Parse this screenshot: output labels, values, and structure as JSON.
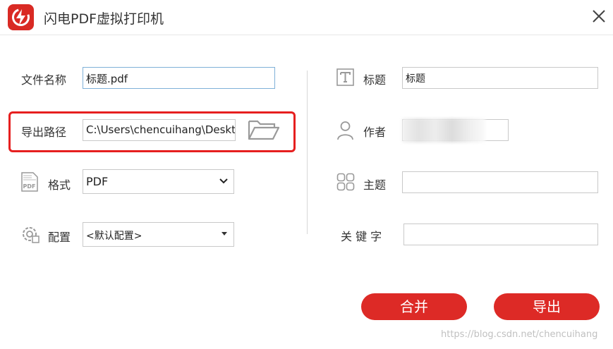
{
  "window": {
    "title": "闪电PDF虚拟打印机"
  },
  "left": {
    "filename_label": "文件名称",
    "filename_value": "标题.pdf",
    "path_label": "导出路径",
    "path_value": "C:\\Users\\chencuihang\\Deskto",
    "format_label": "格式",
    "format_value": "PDF",
    "config_label": "配置",
    "config_value": "<默认配置>"
  },
  "right": {
    "title_label": "标题",
    "title_value": "标题",
    "author_label": "作者",
    "author_value": "",
    "subject_label": "主题",
    "subject_value": "",
    "keywords_label": "关 键 字",
    "keywords_value": ""
  },
  "buttons": {
    "merge": "合并",
    "export": "导出"
  },
  "watermark": "https://blog.csdn.net/chencuihang",
  "colors": {
    "brand_red": "#dd2a26",
    "highlight_red": "#e61f1f",
    "active_border": "#7fb0d8"
  },
  "icons": {
    "logo": "flash-logo-icon",
    "close": "close-icon",
    "folder": "folder-open-icon",
    "pdf": "pdf-format-icon",
    "config": "gear-config-icon",
    "title": "text-t-icon",
    "author": "person-icon",
    "subject": "grid-icon"
  }
}
